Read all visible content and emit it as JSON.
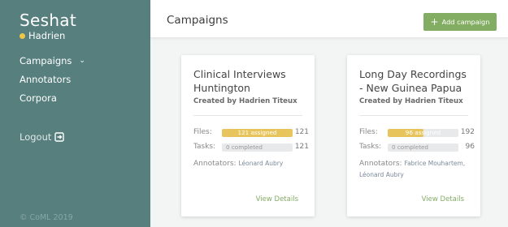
{
  "sidebar": {
    "app_name": "Seshat",
    "user_name": "Hadrien",
    "nav": [
      {
        "label": "Campaigns",
        "has_dropdown": true
      },
      {
        "label": "Annotators"
      },
      {
        "label": "Corpora"
      }
    ],
    "logout_label": "Logout",
    "copyright": "© CoML 2019"
  },
  "header": {
    "title": "Campaigns",
    "add_button_label": "Add campaign"
  },
  "campaigns": [
    {
      "title": "Clinical Interviews Huntington",
      "created_by": "Created by Hadrien Titeux",
      "files_label": "Files:",
      "files_bar_text": "121 assigned",
      "files_progress": 1.0,
      "files_total": "121",
      "tasks_label": "Tasks:",
      "tasks_bar_text": "0 completed",
      "tasks_progress": 0,
      "tasks_total": "121",
      "annotators_label": "Annotators:",
      "annotators": "Léonard Aubry",
      "view_label": "View Details"
    },
    {
      "title": "Long Day Recordings - New Guinea Papua",
      "created_by": "Created by Hadrien Titeux",
      "files_label": "Files:",
      "files_bar_text": "96 assigned",
      "files_progress": 0.5,
      "files_total": "192",
      "tasks_label": "Tasks:",
      "tasks_bar_text": "0 completed",
      "tasks_progress": 0,
      "tasks_total": "96",
      "annotators_label": "Annotators:",
      "annotators": "Fabrice Mouhartem, Léonard Aubry",
      "view_label": "View Details"
    }
  ],
  "colors": {
    "sidebar_bg": "#577f7e",
    "status_dot": "#f0c64a",
    "accent_green": "#82ad62",
    "progress_yellow": "#e8c55c"
  }
}
